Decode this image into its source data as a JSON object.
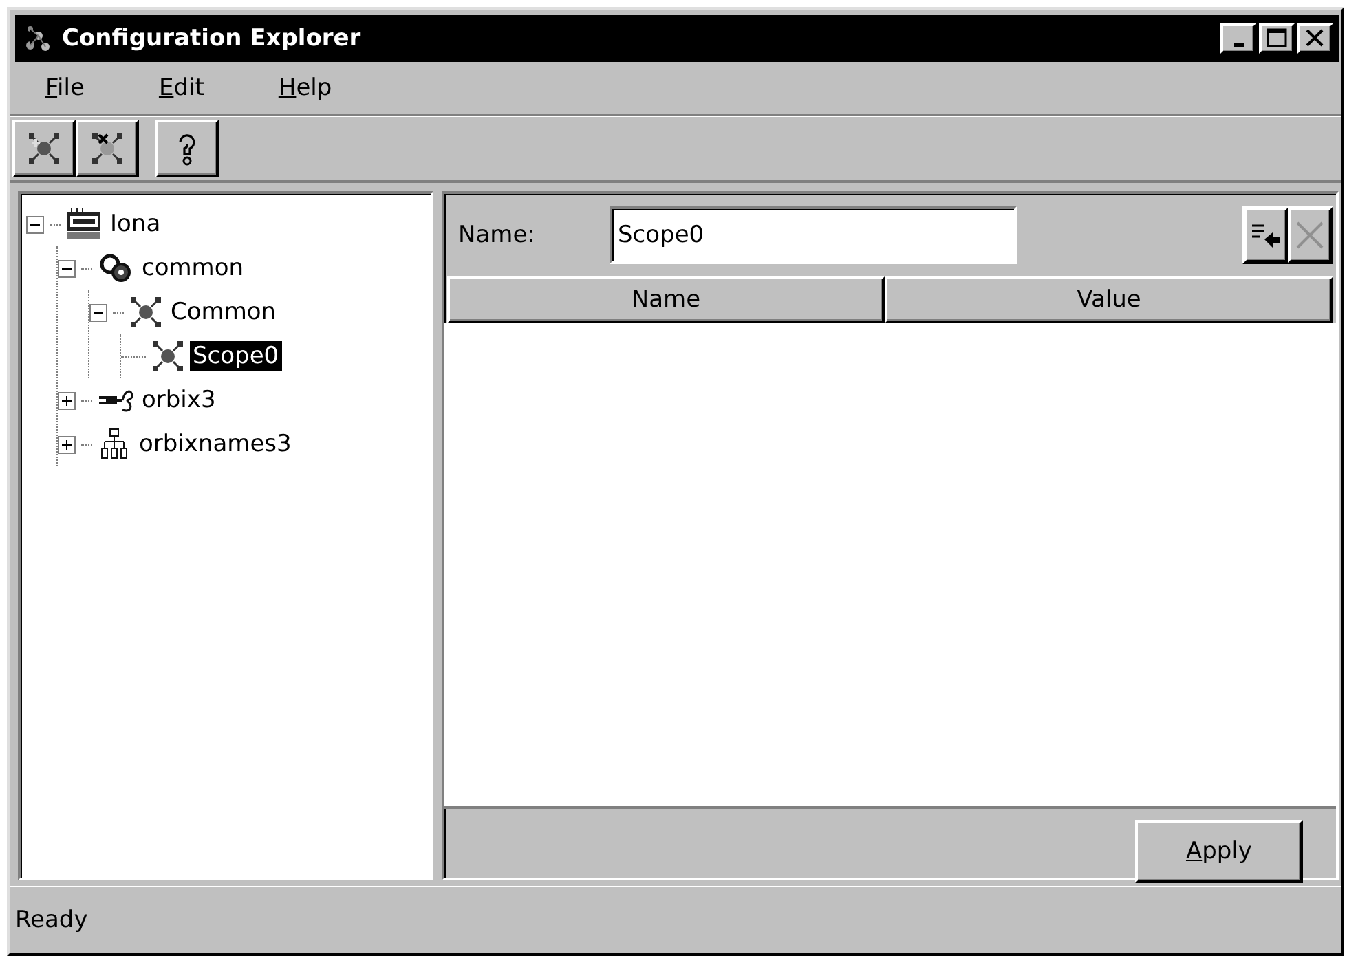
{
  "window": {
    "title": "Configuration Explorer"
  },
  "menu": [
    {
      "label": "File"
    },
    {
      "label": "Edit"
    },
    {
      "label": "Help"
    }
  ],
  "tree": [
    {
      "label": "Iona",
      "kind": "vendor",
      "expanded": true,
      "selected": false,
      "children": [
        {
          "label": "common",
          "kind": "folder",
          "expanded": true,
          "selected": false,
          "children": [
            {
              "label": "Common",
              "kind": "scope",
              "expanded": true,
              "selected": false,
              "children": [
                {
                  "label": "Scope0",
                  "kind": "scope",
                  "selected": true
                }
              ]
            }
          ]
        },
        {
          "label": "orbix3",
          "kind": "plugin",
          "expanded": false,
          "selected": false
        },
        {
          "label": "orbixnames3",
          "kind": "naming",
          "expanded": false,
          "selected": false
        }
      ]
    }
  ],
  "detail": {
    "name_label": "Name:",
    "name_value": "Scope0",
    "actions": [
      {
        "kind": "add",
        "disabled": false
      },
      {
        "kind": "delete",
        "disabled": true
      }
    ],
    "columns": [
      "Name",
      "Value"
    ],
    "apply": "Apply"
  },
  "status_bar": "Ready"
}
